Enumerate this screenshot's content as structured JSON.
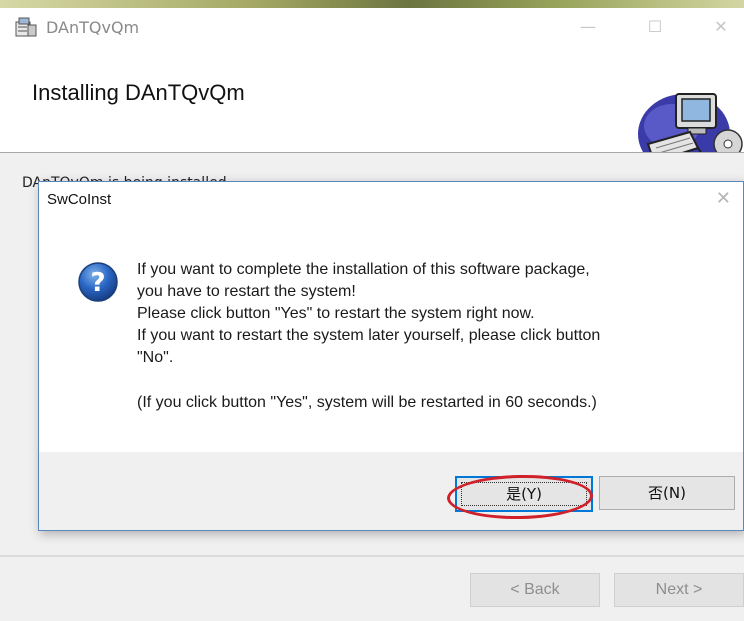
{
  "window": {
    "title": "DAnTQvQm",
    "controls": {
      "minimize": "—",
      "maximize": "☐",
      "close": "✕"
    }
  },
  "header": {
    "title": "Installing DAnTQvQm",
    "art_icon": "computer-cd-icon"
  },
  "body": {
    "status_text": "DAnTQvQm is being installed."
  },
  "footer": {
    "back_label": "< Back",
    "next_label": "Next >"
  },
  "dialog": {
    "title": "SwCoInst",
    "close": "✕",
    "icon": "question-icon",
    "message_lines": [
      "If you want to complete the installation of this software package,",
      "you have to restart the system!",
      "Please click button \"Yes\" to restart the system right now.",
      "If you want to restart the system later yourself, please click button",
      "\"No\"."
    ],
    "note": "(If you click button \"Yes\", system will be restarted in 60 seconds.)",
    "yes_label": "是(Y)",
    "no_label": "否(N)"
  },
  "colors": {
    "accent": "#0078d7",
    "dialog_border": "#5b86be",
    "highlight_ring": "#d0202a",
    "panel": "#f0f0f0"
  }
}
